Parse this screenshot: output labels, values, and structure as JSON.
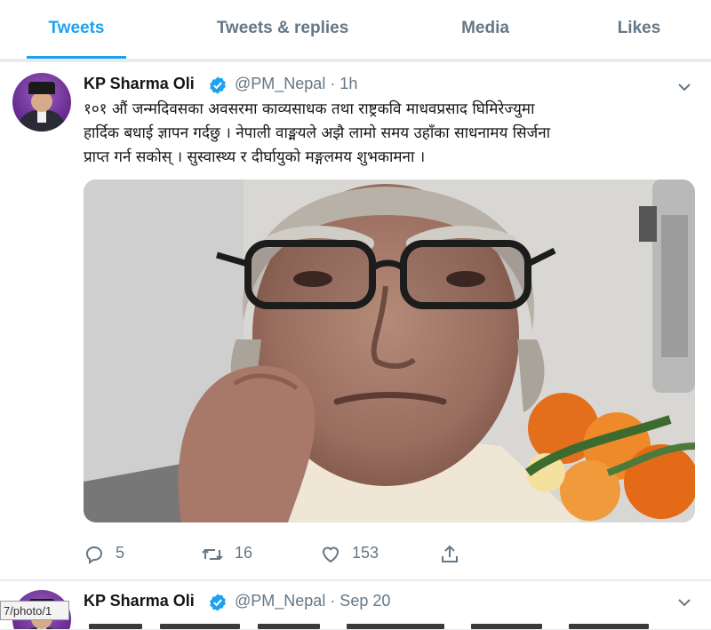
{
  "tabs": [
    {
      "label": "Tweets",
      "active": true
    },
    {
      "label": "Tweets & replies",
      "active": false
    },
    {
      "label": "Media",
      "active": false
    },
    {
      "label": "Likes",
      "active": false
    }
  ],
  "tweets": [
    {
      "author_name": "KP Sharma Oli",
      "verified": true,
      "handle_time": "@PM_Nepal · 1h",
      "text_lines": [
        "१०१ औं जन्मदिवसका अवसरमा काव्यसाधक तथा राष्ट्रकवि माधवप्रसाद घिमिरेज्युमा",
        "हार्दिक बधाई ज्ञापन गर्दछु । नेपाली वाङ्मयले अझै लामो समय उहाँका साधनामय सिर्जना",
        "प्राप्त गर्न सकोस् । सुस्वास्थ्य र  दीर्घायुको मङ्गलमय शुभकामना ।"
      ],
      "replies": "5",
      "retweets": "16",
      "likes": "153",
      "icons": {
        "reply": "reply-icon",
        "retweet": "retweet-icon",
        "like": "heart-icon",
        "share": "share-icon",
        "more": "chevron-down-icon",
        "verified": "verified-badge-icon"
      }
    },
    {
      "author_name": "KP Sharma Oli",
      "verified": true,
      "handle_time": "@PM_Nepal · Sep 20"
    }
  ],
  "status_url": "7/photo/1",
  "colors": {
    "accent": "#1da1f2",
    "secondary_text": "#657786",
    "border": "#e6ecf0"
  }
}
